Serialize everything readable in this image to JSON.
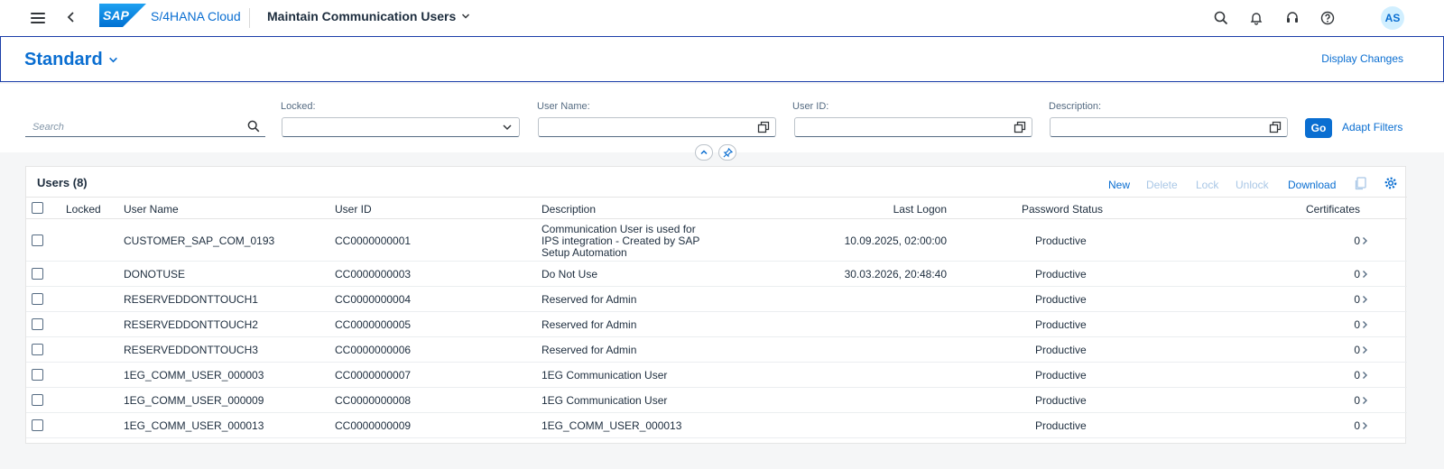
{
  "shell": {
    "logo_text": "SAP",
    "product": "S/4HANA Cloud",
    "app_title": "Maintain Communication Users",
    "user_initials": "AS"
  },
  "variant": {
    "title": "Standard",
    "display_changes": "Display Changes"
  },
  "filters": {
    "search_placeholder": "Search",
    "locked_label": "Locked:",
    "username_label": "User Name:",
    "userid_label": "User ID:",
    "description_label": "Description:",
    "go": "Go",
    "adapt": "Adapt Filters"
  },
  "table": {
    "title": "Users (8)",
    "actions": {
      "new": "New",
      "delete": "Delete",
      "lock": "Lock",
      "unlock": "Unlock",
      "download": "Download"
    },
    "columns": {
      "locked": "Locked",
      "user_name": "User Name",
      "user_id": "User ID",
      "description": "Description",
      "last_logon": "Last Logon",
      "password_status": "Password Status",
      "certificates": "Certificates"
    },
    "rows": [
      {
        "user_name": "CUSTOMER_SAP_COM_0193",
        "user_id": "CC0000000001",
        "description": "Communication User is used for IPS integration - Created by SAP Setup Automation",
        "last_logon": "10.09.2025, 02:00:00",
        "password_status": "Productive",
        "certificates": "0"
      },
      {
        "user_name": "DONOTUSE",
        "user_id": "CC0000000003",
        "description": "Do Not Use",
        "last_logon": "30.03.2026, 20:48:40",
        "password_status": "Productive",
        "certificates": "0"
      },
      {
        "user_name": "RESERVEDDONTTOUCH1",
        "user_id": "CC0000000004",
        "description": "Reserved for Admin",
        "last_logon": "",
        "password_status": "Productive",
        "certificates": "0"
      },
      {
        "user_name": "RESERVEDDONTTOUCH2",
        "user_id": "CC0000000005",
        "description": "Reserved for Admin",
        "last_logon": "",
        "password_status": "Productive",
        "certificates": "0"
      },
      {
        "user_name": "RESERVEDDONTTOUCH3",
        "user_id": "CC0000000006",
        "description": "Reserved for Admin",
        "last_logon": "",
        "password_status": "Productive",
        "certificates": "0"
      },
      {
        "user_name": "1EG_COMM_USER_000003",
        "user_id": "CC0000000007",
        "description": "1EG Communication User",
        "last_logon": "",
        "password_status": "Productive",
        "certificates": "0"
      },
      {
        "user_name": "1EG_COMM_USER_000009",
        "user_id": "CC0000000008",
        "description": "1EG Communication User",
        "last_logon": "",
        "password_status": "Productive",
        "certificates": "0"
      },
      {
        "user_name": "1EG_COMM_USER_000013",
        "user_id": "CC0000000009",
        "description": "1EG_COMM_USER_000013",
        "last_logon": "",
        "password_status": "Productive",
        "certificates": "0"
      }
    ]
  },
  "colors": {
    "accent": "#0a6ed1",
    "variant_border": "#1b3ea8",
    "text": "#1d2d3e"
  }
}
